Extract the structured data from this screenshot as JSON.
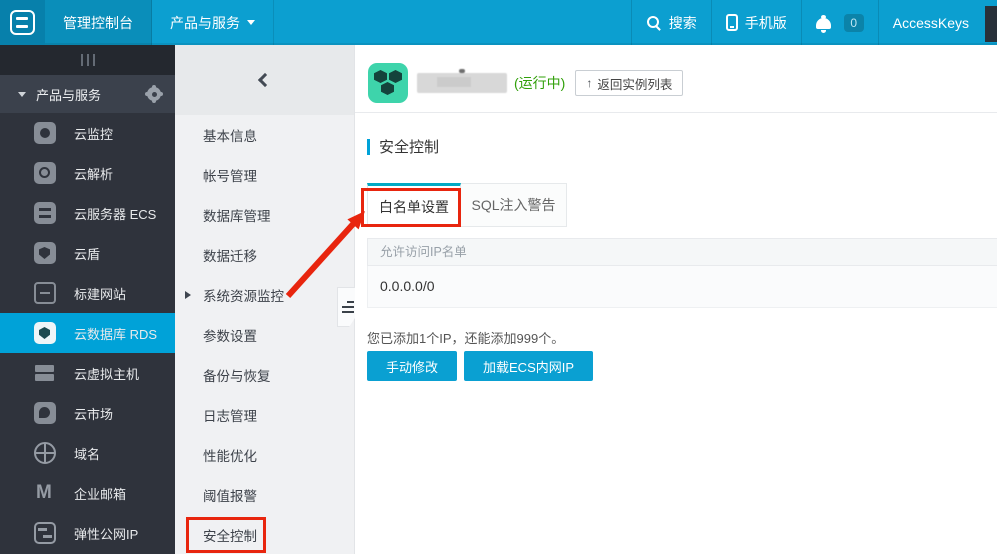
{
  "topbar": {
    "logo_icon": "aliyun-logo-icon",
    "console": "管理控制台",
    "products": "产品与服务",
    "search": "搜索",
    "mobile": "手机版",
    "badge_count": "0",
    "accesskeys": "AccessKeys"
  },
  "sidebar": {
    "header": "产品与服务",
    "items": [
      {
        "label": "云监控",
        "icon": "cloud-monitor-icon"
      },
      {
        "label": "云解析",
        "icon": "dns-icon"
      },
      {
        "label": "云服务器 ECS",
        "icon": "server-icon"
      },
      {
        "label": "云盾",
        "icon": "shield-icon"
      },
      {
        "label": "标建网站",
        "icon": "website-icon"
      },
      {
        "label": "云数据库 RDS",
        "icon": "database-icon",
        "active": true
      },
      {
        "label": "云虚拟主机",
        "icon": "host-icon"
      },
      {
        "label": "云市场",
        "icon": "market-icon"
      },
      {
        "label": "域名",
        "icon": "globe-icon"
      },
      {
        "label": "企业邮箱",
        "icon": "mail-icon"
      },
      {
        "label": "弹性公网IP",
        "icon": "eip-icon"
      }
    ]
  },
  "submenu": {
    "items": [
      "基本信息",
      "帐号管理",
      "数据库管理",
      "数据迁移",
      "系统资源监控",
      "参数设置",
      "备份与恢复",
      "日志管理",
      "性能优化",
      "阈值报警",
      "安全控制"
    ]
  },
  "main": {
    "status": "(运行中)",
    "back_button": "返回实例列表",
    "section_title": "安全控制",
    "tabs": [
      "白名单设置",
      "SQL注入警告"
    ],
    "table": {
      "header": "允许访问IP名单",
      "rows": [
        "0.0.0.0/0"
      ]
    },
    "note": "您已添加1个IP，还能添加999个。",
    "buttons": [
      "手动修改",
      "加载ECS内网IP"
    ]
  },
  "colors": {
    "accent": "#0aa0d2",
    "annotation_red": "#e8250e",
    "status_green": "#31a00a",
    "sidebar_bg": "#2f333c"
  }
}
